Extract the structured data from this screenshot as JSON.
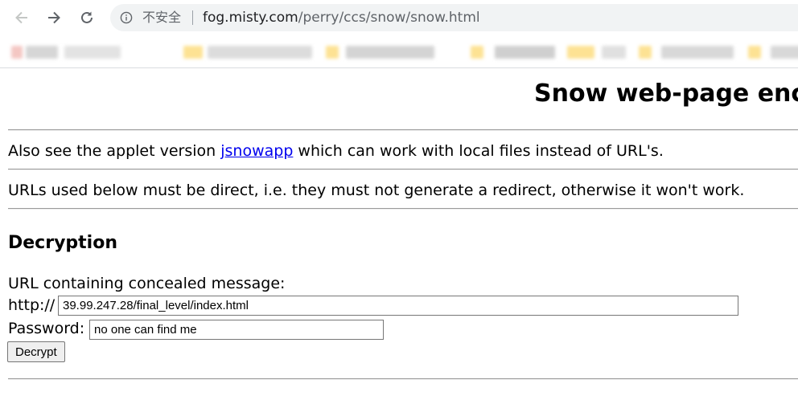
{
  "browser": {
    "security_label": "不安全",
    "url_host": "fog.misty.com",
    "url_path": "/perry/ccs/snow/snow.html",
    "bookmark_colors": [
      "#f4c7c3",
      "#fde293",
      "#bdbdbd",
      "#fde293",
      "#e0e0e0",
      "#fde293"
    ]
  },
  "page": {
    "title": "Snow web-page encryption",
    "applet_para": {
      "before": "Also see the applet version ",
      "link": "jsnowapp",
      "after": " which can work with local files instead of URL's."
    },
    "redirect_note": "URLs used below must be direct, i.e. they must not generate a redirect, otherwise it won't work.",
    "decryption": {
      "heading": "Decryption",
      "url_label": "URL containing concealed message:",
      "scheme_label": "http://",
      "url_value": "39.99.247.28/final_level/index.html",
      "password_label": "Password:",
      "password_value": "no one can find me",
      "button_label": "Decrypt"
    }
  }
}
